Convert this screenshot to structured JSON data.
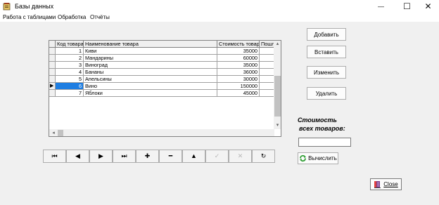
{
  "window": {
    "title": "Базы данных",
    "minimize_glyph": "—",
    "maximize_glyph": "☐",
    "close_glyph": "✕"
  },
  "menu": [
    "Работа с таблицами",
    "Обработка",
    "Отчёты"
  ],
  "grid": {
    "columns": [
      "Код товара",
      "Наименование товара",
      "Стоимость товара",
      "Пошл"
    ],
    "rows": [
      {
        "code": "1",
        "name": "Киви",
        "price": "35000"
      },
      {
        "code": "2",
        "name": "Мандарины",
        "price": "60000"
      },
      {
        "code": "3",
        "name": "Виноград",
        "price": "35000"
      },
      {
        "code": "4",
        "name": "Бананы",
        "price": "36000"
      },
      {
        "code": "5",
        "name": "Апельсины",
        "price": "30000"
      },
      {
        "code": "6",
        "name": "Вино",
        "price": "150000"
      },
      {
        "code": "7",
        "name": "Яблоки",
        "price": "45000"
      }
    ],
    "current_row_indicator": "▶",
    "scroll_up": "▴",
    "scroll_down": "▾",
    "scroll_left": "◂"
  },
  "navigator": [
    "⏮",
    "◀",
    "▶",
    "⏭",
    "✚",
    "━",
    "▲",
    "✓",
    "✕",
    "↻"
  ],
  "buttons": {
    "add": "Добавить",
    "insert": "Вставить",
    "edit": "Изменить",
    "delete": "Удалить",
    "calculate": "Вычислить",
    "close": "Close"
  },
  "total": {
    "label_line1": "Стоимость",
    "label_line2": "всех товаров:",
    "value": ""
  },
  "colors": {
    "selection": "#1e7ee2",
    "calc_icon": "#2e9d32",
    "close_icon": "#7a3a8a"
  }
}
